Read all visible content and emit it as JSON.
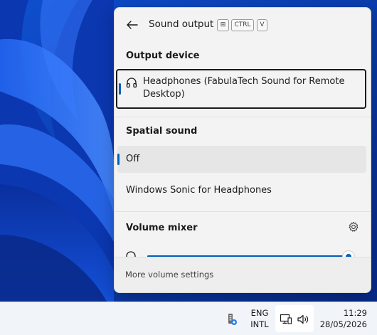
{
  "flyout": {
    "title": "Sound output",
    "shortcut_keys": [
      "⊞",
      "CTRL",
      "V"
    ],
    "output_device": {
      "heading": "Output device",
      "devices": [
        {
          "label": "Headphones (FabulaTech Sound for Remote Desktop)",
          "icon": "headphones-icon",
          "selected": true
        }
      ]
    },
    "spatial_sound": {
      "heading": "Spatial sound",
      "options": [
        {
          "label": "Off",
          "selected": true
        },
        {
          "label": "Windows Sonic for Headphones",
          "selected": false
        }
      ]
    },
    "volume_mixer": {
      "heading": "Volume mixer",
      "level_fraction": 1.0
    },
    "footer_link": "More volume settings"
  },
  "taskbar": {
    "language_line1": "ENG",
    "language_line2": "INTL",
    "time": "11:29",
    "date": "28/05/2026"
  },
  "colors": {
    "accent": "#005fb8",
    "wallpaper": "#0a3cae",
    "flyout_bg": "#f3f3f3",
    "taskbar_bg": "#f1f4f9"
  }
}
